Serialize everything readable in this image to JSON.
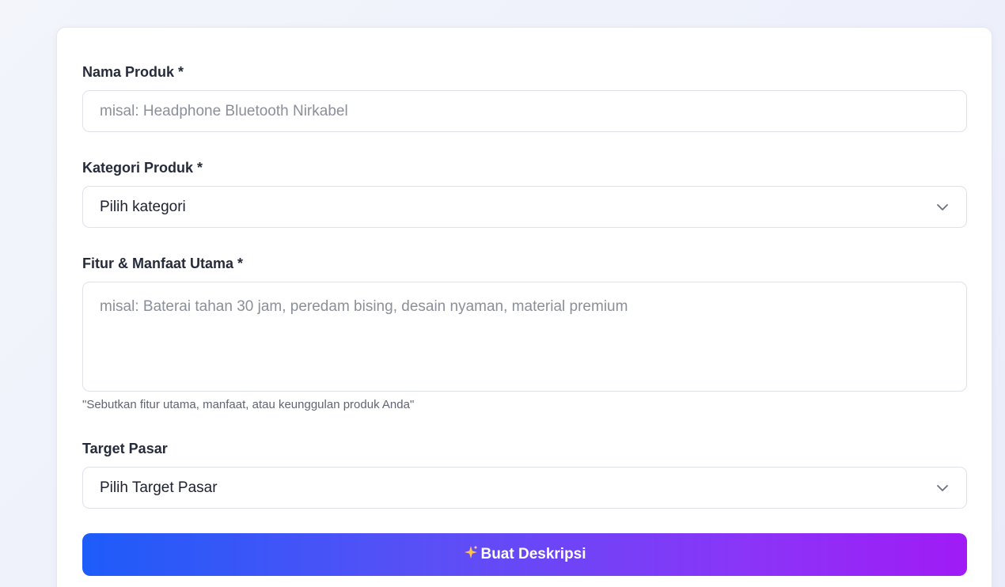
{
  "form": {
    "product_name": {
      "label": "Nama Produk *",
      "placeholder": "misal: Headphone Bluetooth Nirkabel",
      "value": ""
    },
    "category": {
      "label": "Kategori Produk *",
      "selected": "Pilih kategori"
    },
    "features": {
      "label": "Fitur & Manfaat Utama *",
      "placeholder": "misal: Baterai tahan 30 jam, peredam bising, desain nyaman, material premium",
      "hint": "\"Sebutkan fitur utama, manfaat, atau keunggulan produk Anda\""
    },
    "target_market": {
      "label": "Target Pasar",
      "selected": "Pilih Target Pasar"
    },
    "submit": {
      "icon": "sparkles-icon",
      "label": "Buat Deskripsi"
    }
  },
  "colors": {
    "button_gradient_start": "#1d5cf9",
    "button_gradient_end": "#a01bf6",
    "label_text": "#252b3b",
    "placeholder_text": "#8b8f99"
  }
}
